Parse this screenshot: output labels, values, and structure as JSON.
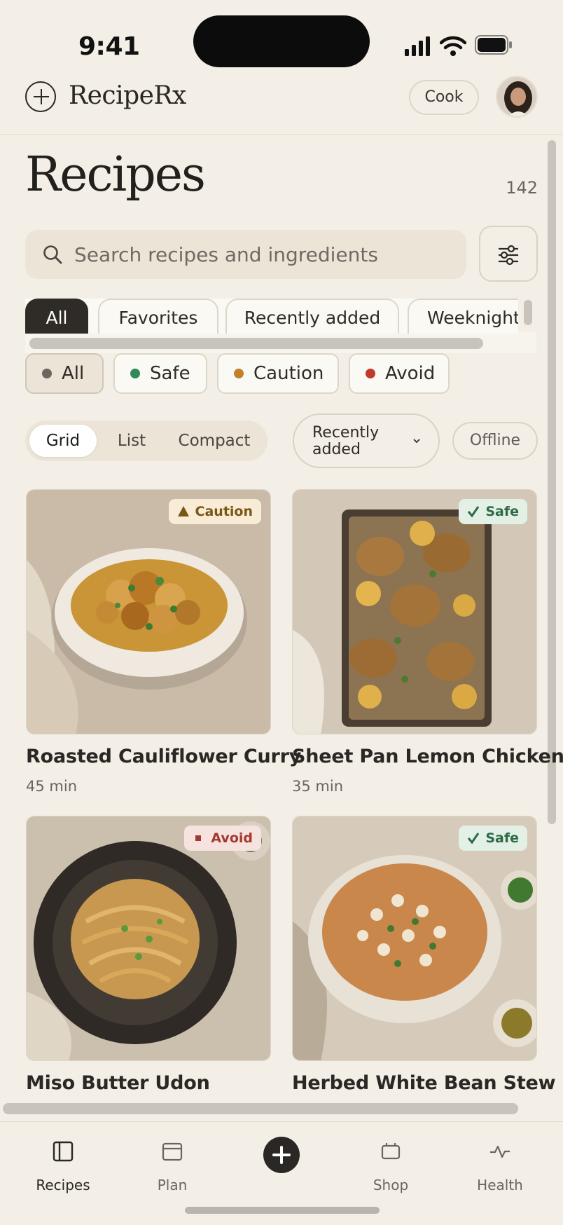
{
  "status_bar": {
    "time": "9:41"
  },
  "header": {
    "brand": "RecipeRx",
    "cook_label": "Cook"
  },
  "page": {
    "title": "Recipes",
    "count": "142"
  },
  "search": {
    "placeholder": "Search recipes and ingredients"
  },
  "collections": [
    {
      "label": "All",
      "active": true
    },
    {
      "label": "Favorites",
      "active": false
    },
    {
      "label": "Recently added",
      "active": false
    },
    {
      "label": "Weeknight",
      "active": false
    }
  ],
  "safety_filters": [
    {
      "label": "All",
      "color": "#6b665f",
      "active": true
    },
    {
      "label": "Safe",
      "color": "#2f8a57",
      "active": false
    },
    {
      "label": "Caution",
      "color": "#c1812a",
      "active": false
    },
    {
      "label": "Avoid",
      "color": "#c0392b",
      "active": false
    }
  ],
  "view_modes": [
    {
      "label": "Grid",
      "active": true
    },
    {
      "label": "List",
      "active": false
    },
    {
      "label": "Compact",
      "active": false
    }
  ],
  "sort": {
    "label": "Recently added"
  },
  "offline_label": "Offline",
  "recipes": [
    {
      "title": "Roasted Cauliflower Curry",
      "time": "45 min",
      "badge": "Caution",
      "badge_type": "caution"
    },
    {
      "title": "Sheet Pan Lemon Chicken",
      "time": "35 min",
      "badge": "Safe",
      "badge_type": "safe"
    },
    {
      "title": "Miso Butter Udon",
      "time": "",
      "badge": "Avoid",
      "badge_type": "avoid"
    },
    {
      "title": "Herbed White Bean Stew",
      "time": "",
      "badge": "Safe",
      "badge_type": "safe"
    }
  ],
  "tabs": [
    {
      "label": "Recipes",
      "icon": "recipes-icon",
      "active": true
    },
    {
      "label": "Plan",
      "icon": "plan-icon",
      "active": false
    },
    {
      "label": "Shop",
      "icon": "shop-icon",
      "active": false
    },
    {
      "label": "Health",
      "icon": "health-icon",
      "active": false
    }
  ],
  "colors": {
    "background": "#f3efe6",
    "accent": "#2a2724",
    "safe": "#2f8a57",
    "caution": "#c1812a",
    "avoid": "#c0392b"
  }
}
